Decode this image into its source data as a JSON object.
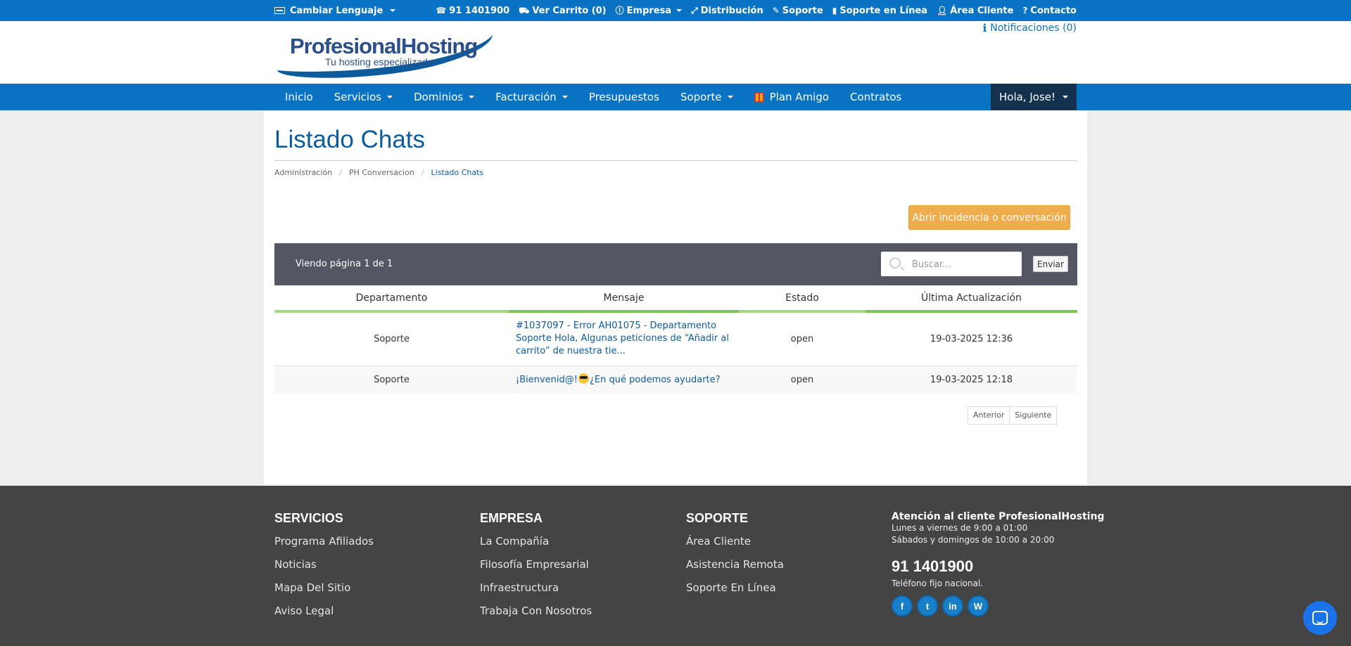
{
  "colors": {
    "brand_blue": "#0a73c4",
    "nav_user_bg": "#14324f",
    "title_blue": "#0d5b9c",
    "accent_orange": "#f0ad4e",
    "table_bar": "#555663",
    "header_underline": "#a6d785",
    "footer_bg": "#444444"
  },
  "topbar": {
    "language": "Cambiar Lenguaje",
    "links": [
      {
        "icon": "headset-icon",
        "label": "91 1401900"
      },
      {
        "icon": "cart-icon",
        "label": "Ver Carrito (0)"
      },
      {
        "icon": "info-circle-icon",
        "label": "Empresa"
      },
      {
        "icon": "expand-icon",
        "label": "Distribución"
      },
      {
        "icon": "wrench-icon",
        "label": "Soporte"
      },
      {
        "icon": "book-icon",
        "label": "Soporte en Línea"
      },
      {
        "icon": "user-icon",
        "label": "Área Cliente"
      },
      {
        "icon": "question-circle-icon",
        "label": "Contacto"
      }
    ]
  },
  "header": {
    "logo_text": "ProfesionalHosting",
    "logo_tagline": "Tu hosting especializado",
    "notifications": "Notificaciones (0)"
  },
  "nav": {
    "items": [
      {
        "label": "Inicio",
        "dropdown": false
      },
      {
        "label": "Servicios",
        "dropdown": true
      },
      {
        "label": "Dominios",
        "dropdown": true
      },
      {
        "label": "Facturación",
        "dropdown": true
      },
      {
        "label": "Presupuestos",
        "dropdown": false
      },
      {
        "label": "Soporte",
        "dropdown": true
      },
      {
        "label": "Plan Amigo",
        "dropdown": false,
        "icon": "gift-icon"
      },
      {
        "label": "Contratos",
        "dropdown": false
      }
    ],
    "user_greeting": "Hola, Jose!"
  },
  "page": {
    "title": "Listado Chats",
    "breadcrumb": [
      "Administración",
      "PH Conversacion",
      "Listado Chats"
    ],
    "open_button": "Abrir incidencia o conversación",
    "page_info": "Viendo página 1 de 1",
    "search_placeholder": "Buscar...",
    "send_button": "Enviar",
    "columns": [
      "Departamento",
      "Mensaje",
      "Estado",
      "Última Actualización"
    ],
    "rows": [
      {
        "department": "Soporte",
        "message": "#1037097 - Error AH01075 - Departamento Soporte Hola, Algunas peticiones de “Añadir al carrito” de nuestra tie...",
        "status": "open",
        "updated": "19-03-2025 12:36"
      },
      {
        "department": "Soporte",
        "message_before": "¡Bienvenid@!",
        "message_after": "¿En qué podemos ayudarte?",
        "status": "open",
        "updated": "19-03-2025 12:18"
      }
    ],
    "pager": {
      "prev": "Anterior",
      "next": "Siguiente"
    }
  },
  "footer": {
    "columns": [
      {
        "title": "SERVICIOS",
        "links": [
          "Programa Afiliados",
          "Noticias",
          "Mapa Del Sitio",
          "Aviso Legal"
        ]
      },
      {
        "title": "EMPRESA",
        "links": [
          "La Compañía",
          "Filosofía Empresarial",
          "Infraestructura",
          "Trabaja Con Nosotros"
        ]
      },
      {
        "title": "SOPORTE",
        "links": [
          "Área Cliente",
          "Asistencia Remota",
          "Soporte En Línea"
        ]
      }
    ],
    "contact": {
      "heading": "Atención al cliente ProfesionalHosting",
      "hours_weekdays": "Lunes a viernes de 9:00 a 01:00",
      "hours_weekend": "Sábados y domingos de 10:00 a 20:00",
      "phone": "91 1401900",
      "phone_note": "Teléfono fijo nacional.",
      "social": [
        {
          "name": "facebook-icon",
          "glyph": "f"
        },
        {
          "name": "twitter-icon",
          "glyph": "t"
        },
        {
          "name": "linkedin-icon",
          "glyph": "in"
        },
        {
          "name": "wordpress-icon",
          "glyph": "W"
        }
      ]
    }
  }
}
